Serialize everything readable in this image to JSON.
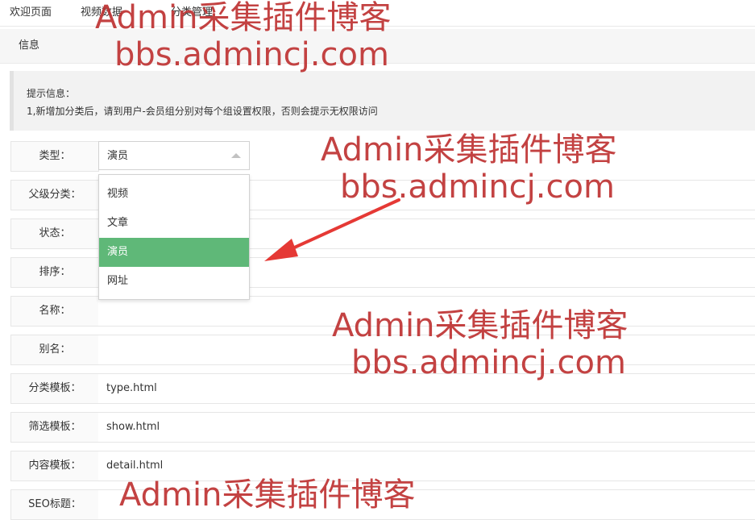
{
  "tabs": [
    "欢迎页面",
    "视频数据",
    "分类管理"
  ],
  "subtab": "信息",
  "notice": {
    "title": "提示信息：",
    "line": "1,新增加分类后，请到用户-会员组分别对每个组设置权限，否则会提示无权限访问"
  },
  "form": {
    "type_label": "类型：",
    "type_value": "演员",
    "type_options": [
      "视频",
      "文章",
      "演员",
      "网址"
    ],
    "type_selected_index": 2,
    "parent_label": "父级分类：",
    "status_label": "状态：",
    "sort_label": "排序：",
    "name_label": "名称：",
    "alias_label": "别名：",
    "cat_tpl_label": "分类模板：",
    "cat_tpl_value": "type.html",
    "filter_tpl_label": "筛选模板：",
    "filter_tpl_value": "show.html",
    "content_tpl_label": "内容模板：",
    "content_tpl_value": "detail.html",
    "seo_title_label": "SEO标题："
  },
  "colors": {
    "selected_option": "#5fb878",
    "watermark": "#be3232",
    "arrow": "#e53935"
  },
  "watermarks": [
    {
      "line1": "Admin采集插件博客",
      "line2": "bbs.admincj.com"
    },
    {
      "line1": "Admin采集插件博客",
      "line2": "bbs.admincj.com"
    },
    {
      "line1": "Admin采集插件博客",
      "line2": "bbs.admincj.com"
    },
    {
      "line1": "Admin采集插件博客",
      "line2": ""
    }
  ]
}
